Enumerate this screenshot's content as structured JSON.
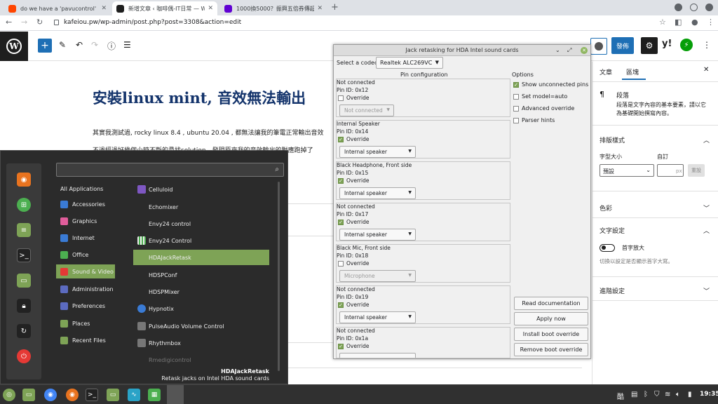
{
  "browser": {
    "tabs": [
      {
        "title": "do we have a 'pavucontrol' lik",
        "color": "#ff4500"
      },
      {
        "title": "新增文章 ‹ 咖啡偶-IT日常 — W",
        "color": "#1e1e1e"
      },
      {
        "title": "1000換5000？振興五倍券傳超",
        "color": "#6001d2"
      }
    ],
    "new_tab": "+",
    "url": "kafeiou.pw/wp-admin/post.php?post=3308&action=edit"
  },
  "wp": {
    "logo": "W",
    "add": "+",
    "publish_label": "發佈",
    "yoast": "y!",
    "post_title": "安裝linux mint, 音效無法輸出",
    "paragraphs": [
      "其實我測試過, rocky linux 8.4 , ubuntu 20.04 , 都無法讓我的筆電正常輸出音效",
      "不過經過好幾個小時不斷的尋找solution，發現原來我的音效輸出的對應跑掉了"
    ],
    "sidebar": {
      "tab_document": "文章",
      "tab_block": "區塊",
      "block_icon": "¶",
      "block_name": "段落",
      "block_desc_1": "段落是文字內容的基本要素，請以它",
      "block_desc_2": "為基礎開始撰寫內容。",
      "typography": "排版樣式",
      "font_size": "字型大小",
      "custom": "自訂",
      "size_value": "預設",
      "px": "px",
      "reset": "重設",
      "color": "色彩",
      "text_settings": "文字設定",
      "drop_cap": "首字放大",
      "drop_cap_help": "切換以設定是否顯示首字大寫。",
      "advanced": "進階設定"
    }
  },
  "menu": {
    "categories": [
      {
        "label": "All Applications",
        "color": ""
      },
      {
        "label": "Accessories",
        "color": "#3a7bd5"
      },
      {
        "label": "Graphics",
        "color": "#e05d9b"
      },
      {
        "label": "Internet",
        "color": "#3a7bd5"
      },
      {
        "label": "Office",
        "color": "#4caf50"
      },
      {
        "label": "Sound & Video",
        "color": "#e53935",
        "active": true
      },
      {
        "label": "Administration",
        "color": "#5c6bc0"
      },
      {
        "label": "Preferences",
        "color": "#5c6bc0"
      },
      {
        "label": "Places",
        "color": "#7ea356"
      },
      {
        "label": "Recent Files",
        "color": "#7ea356"
      }
    ],
    "apps": [
      {
        "label": "Celluloid",
        "color": "#7e57c2"
      },
      {
        "label": "Echomixer",
        "color": ""
      },
      {
        "label": "Envy24 control",
        "color": ""
      },
      {
        "label": "Envy24 Control",
        "color": "#eeeeee"
      },
      {
        "label": "HDAJackRetask",
        "color": "",
        "active": true
      },
      {
        "label": "HDSPConf",
        "color": ""
      },
      {
        "label": "HDSPMixer",
        "color": ""
      },
      {
        "label": "Hypnotix",
        "color": "#3a7bd5"
      },
      {
        "label": "PulseAudio Volume Control",
        "color": "#777777"
      },
      {
        "label": "Rhythmbox",
        "color": "#777777"
      },
      {
        "label": "Rmedigicontrol",
        "color": "",
        "dim": true
      }
    ],
    "desc_title": "HDAJackRetask",
    "desc_text": "Retask jacks on Intel HDA sound cards"
  },
  "hda": {
    "title": "Jack retasking for HDA Intel sound cards",
    "codec_label": "Select a codec:",
    "codec_value": "Realtek ALC269VC",
    "pin_config": "Pin configuration",
    "options": "Options",
    "option_items": [
      {
        "label": "Show unconnected pins",
        "checked": true
      },
      {
        "label": "Set model=auto",
        "checked": false
      },
      {
        "label": "Advanced override",
        "checked": false
      },
      {
        "label": "Parser hints",
        "checked": false
      }
    ],
    "pins": [
      {
        "name": "Not connected",
        "id": "Pin ID: 0x12",
        "override": false,
        "value": "Not connected"
      },
      {
        "name": "Internal Speaker",
        "id": "Pin ID: 0x14",
        "override": true,
        "value": "Internal speaker"
      },
      {
        "name": "Black Headphone, Front side",
        "id": "Pin ID: 0x15",
        "override": true,
        "value": "Internal speaker"
      },
      {
        "name": "Not connected",
        "id": "Pin ID: 0x17",
        "override": true,
        "value": "Internal speaker"
      },
      {
        "name": "Black Mic, Front side",
        "id": "Pin ID: 0x18",
        "override": false,
        "value": "Microphone"
      },
      {
        "name": "Not connected",
        "id": "Pin ID: 0x19",
        "override": true,
        "value": "Internal speaker"
      },
      {
        "name": "Not connected",
        "id": "Pin ID: 0x1a",
        "override": true,
        "value": ""
      }
    ],
    "override_label": "Override",
    "buttons": [
      "Read documentation",
      "Apply now",
      "Install boot override",
      "Remove boot override"
    ]
  },
  "panel": {
    "clock": "19:35"
  }
}
